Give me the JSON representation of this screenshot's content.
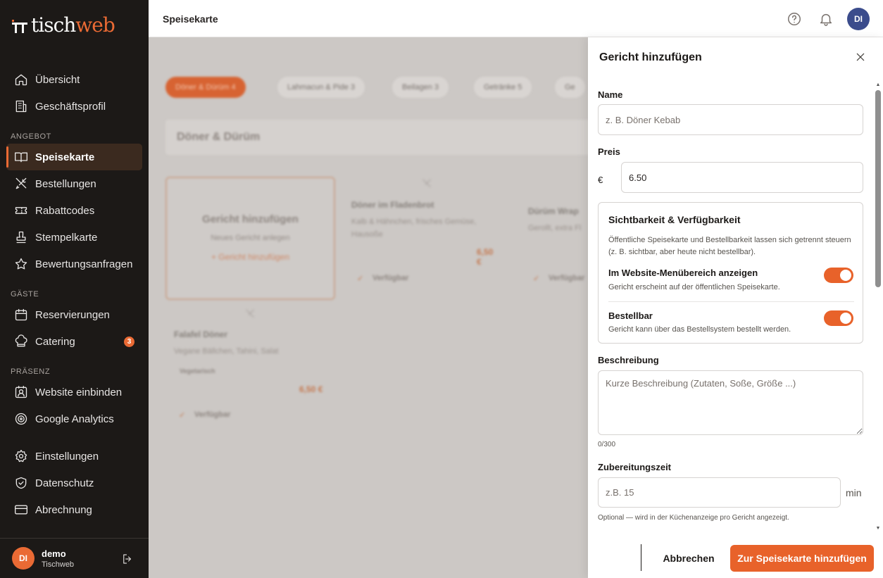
{
  "brand": {
    "name_part1": "tisch",
    "name_part2": "web",
    "accent": "#ea6a34"
  },
  "sidebar": {
    "top_items": [
      {
        "label": "Übersicht",
        "icon": "home-icon"
      },
      {
        "label": "Geschäftsprofil",
        "icon": "building-icon"
      }
    ],
    "sections": [
      {
        "title": "ANGEBOT",
        "items": [
          {
            "label": "Speisekarte",
            "icon": "book-open-icon",
            "active": true
          },
          {
            "label": "Bestellungen",
            "icon": "utensils-icon"
          },
          {
            "label": "Rabattcodes",
            "icon": "ticket-icon"
          },
          {
            "label": "Stempelkarte",
            "icon": "stamp-icon"
          },
          {
            "label": "Bewertungsanfragen",
            "icon": "star-icon"
          }
        ]
      },
      {
        "title": "GÄSTE",
        "items": [
          {
            "label": "Reservierungen",
            "icon": "calendar-icon"
          },
          {
            "label": "Catering",
            "icon": "chef-hat-icon",
            "badge": "3"
          }
        ]
      },
      {
        "title": "PRÄSENZ",
        "items": [
          {
            "label": "Website einbinden",
            "icon": "contact-card-icon"
          },
          {
            "label": "Google Analytics",
            "icon": "target-icon"
          }
        ]
      }
    ],
    "bottom_items": [
      {
        "label": "Einstellungen",
        "icon": "gear-icon"
      },
      {
        "label": "Datenschutz",
        "icon": "shield-icon"
      },
      {
        "label": "Abrechnung",
        "icon": "credit-card-icon"
      }
    ],
    "user": {
      "initials": "DI",
      "name": "demo",
      "subtitle": "Tischweb"
    }
  },
  "header": {
    "title": "Speisekarte",
    "avatar_initials": "DI"
  },
  "main": {
    "category_chips": [
      "Döner & Dürüm 4",
      "Lahmacun & Pide 3",
      "Beilagen 3",
      "Getränke 5",
      "Ge"
    ],
    "category_title": "Döner & Dürüm",
    "add_card": {
      "title": "Gericht hinzufügen",
      "subtitle": "Neues Gericht anlegen",
      "link": "+ Gericht hinzufügen"
    },
    "dishes": [
      {
        "name": "Döner im Fladenbrot",
        "description": "Kalb & Hähnchen, frisches Gemüse, Hausoße",
        "price": "6,50 €",
        "availability": "Verfügbar"
      },
      {
        "name": "Dürüm Wrap",
        "description": "Gerollt, extra Fl",
        "price": "",
        "availability": "Verfügbar"
      },
      {
        "name": "Falafel Döner",
        "description": "Vegane Bällchen, Tahini, Salat",
        "tag": "Vegetarisch",
        "price": "6,50 €",
        "availability": "Verfügbar"
      }
    ]
  },
  "panel": {
    "title": "Gericht hinzufügen",
    "name_label": "Name",
    "name_placeholder": "z. B. Döner Kebab",
    "price_label": "Preis",
    "currency": "€",
    "price_value": "6.50",
    "visibility": {
      "title": "Sichtbarkeit & Verfügbarkeit",
      "description": "Öffentliche Speisekarte und Bestellbarkeit lassen sich getrennt steuern (z. B. sichtbar, aber heute nicht bestellbar).",
      "website_title": "Im Website-Menübereich anzeigen",
      "website_sub": "Gericht erscheint auf der öffentlichen Speisekarte.",
      "website_on": true,
      "orderable_title": "Bestellbar",
      "orderable_sub": "Gericht kann über das Bestellsystem bestellt werden.",
      "orderable_on": true
    },
    "description_label": "Beschreibung",
    "description_placeholder": "Kurze Beschreibung (Zutaten, Soße, Größe ...)",
    "description_counter": "0/300",
    "prep_label": "Zubereitungszeit",
    "prep_placeholder": "z.B. 15",
    "prep_unit": "min",
    "prep_hint": "Optional — wird in der Küchenanzeige pro Gericht angezeigt.",
    "cancel_label": "Abbrechen",
    "submit_label": "Zur Speisekarte hinzufügen"
  }
}
